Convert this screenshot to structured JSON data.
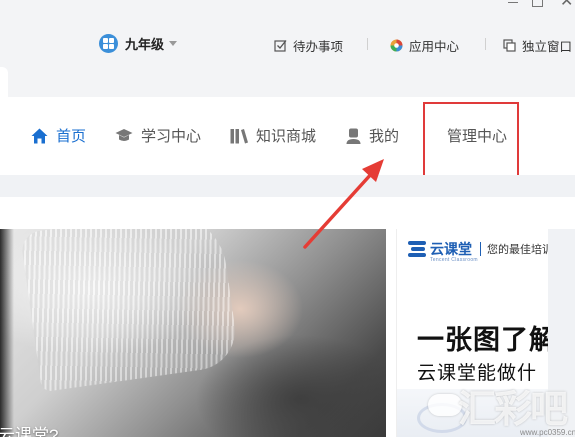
{
  "window": {
    "controls": [
      "minimize",
      "maximize",
      "close"
    ]
  },
  "toolbar": {
    "grade_label": "九年级",
    "todo_label": "待办事项",
    "apps_label": "应用中心",
    "window_label": "独立窗口"
  },
  "nav": {
    "items": [
      {
        "label": "首页",
        "icon": "home-icon",
        "active": true
      },
      {
        "label": "学习中心",
        "icon": "graduation-cap-icon",
        "active": false
      },
      {
        "label": "知识商城",
        "icon": "books-icon",
        "active": false
      },
      {
        "label": "我的",
        "icon": "user-icon",
        "active": false
      },
      {
        "label": "管理中心",
        "icon": "",
        "active": false,
        "highlighted": true
      }
    ],
    "active_color": "#1a6fd0",
    "highlight_color": "#e03a3a"
  },
  "banner_left": {
    "caption": "云课堂?"
  },
  "banner_right": {
    "brand": "云课堂",
    "brand_sub": "Tencent Classroom",
    "slogan": "您的最佳培训",
    "title": "一张图了解",
    "line2": "云课堂能做什"
  },
  "watermark": {
    "text": "汇彩吧",
    "url": "www.pc0359.cn"
  }
}
